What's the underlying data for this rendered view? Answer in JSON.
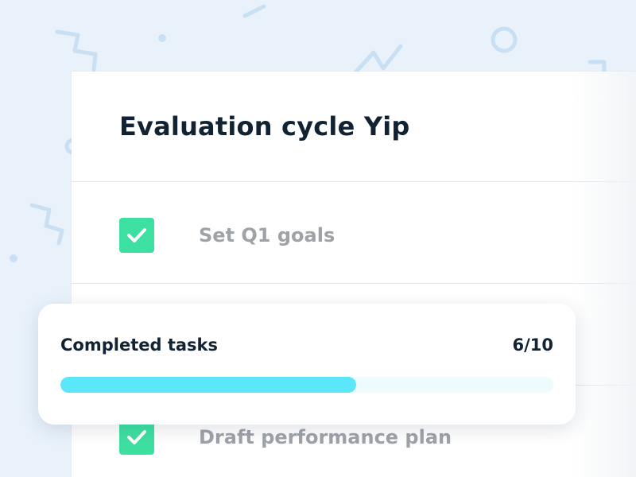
{
  "card": {
    "title": "Evaluation cycle Yip"
  },
  "tasks": [
    {
      "label": "Set Q1 goals",
      "checked": true,
      "icon": "check-icon"
    },
    {
      "label": "Draft performance plan",
      "checked": true,
      "icon": "check-icon"
    }
  ],
  "progress": {
    "label": "Completed tasks",
    "count": "6/10",
    "completed": 6,
    "total": 10,
    "fill_color": "#5ce6fa",
    "track_color": "#eefafd"
  },
  "colors": {
    "background": "#e9f2fb",
    "checkbox": "#3ee0a2",
    "title_text": "#112233",
    "task_text": "#9ea3a8"
  }
}
